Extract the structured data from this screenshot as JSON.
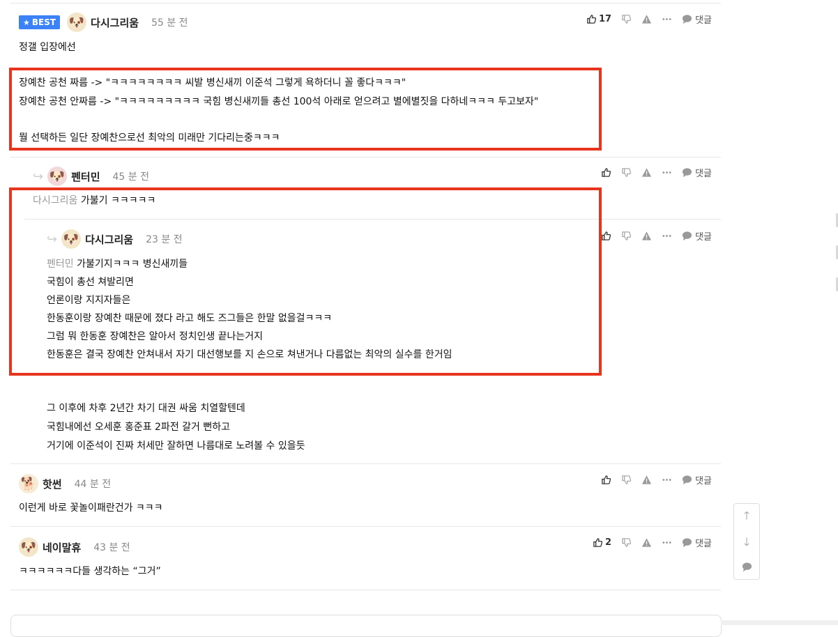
{
  "comments": [
    {
      "badge": "BEST",
      "author": "다시그리움",
      "time": "55 분 전",
      "likes": "17",
      "reply_label": "댓글",
      "lines": [
        "정갤 입장에선",
        "장예찬 공천 짜름 -> \"ㅋㅋㅋㅋㅋㅋㅋㅋ 씨발 병신새끼 이준석 그렇게 욕하더니 꼴 좋다ㅋㅋㅋ\"",
        "장예찬 공천 안짜름 -> \"ㅋㅋㅋㅋㅋㅋㅋㅋㅋ 국힘 병신새끼들 총선 100석 아래로 얻으려고 별에별짓을 다하네ㅋㅋㅋ 두고보자\"",
        "뭘 선택하든 일단 장예찬으로선 최악의 미래만 기다리는중ㅋㅋㅋ"
      ]
    },
    {
      "author": "펜터민",
      "time": "45 분 전",
      "reply_label": "댓글",
      "mention": "다시그리움",
      "text": "가불기 ㅋㅋㅋㅋㅋ"
    },
    {
      "author": "다시그리움",
      "time": "23 분 전",
      "reply_label": "댓글",
      "mention": "펜터민",
      "first_text": "가불기지ㅋㅋㅋ 병신새끼들",
      "lines": [
        "국힘이 총선 쳐발리면",
        "언론이랑 지지자들은",
        "한동훈이랑 장예찬 때문에 졌다 라고 해도 즈그들은 한말 없을걸ㅋㅋㅋ",
        "그럼 뭐 한동훈 장예찬은 알아서 정치인생 끝나는거지",
        "한동훈은 결국 장예찬 안쳐내서 자기 대선행보를 지 손으로 쳐낸거나 다름없는 최악의 실수를 한거임",
        "그 이후에 차후 2년간 차기 대권 싸움 치열할텐데",
        "국힘내에선 오세훈 홍준표 2파전 갈거 뻔하고",
        "거기에 이준석이 진짜 처세만 잘하면 나름대로 노려볼 수 있을듯"
      ]
    },
    {
      "author": "핫썬",
      "time": "44 분 전",
      "reply_label": "댓글",
      "text": "이런게 바로 꽃놀이패란건가 ㅋㅋㅋ"
    },
    {
      "author": "네이말휴",
      "time": "43 분 전",
      "likes": "2",
      "reply_label": "댓글",
      "text": "ㅋㅋㅋㅋㅋㅋ다들 생각하는 “그거”"
    }
  ],
  "icons": {
    "like": "thumbs-up-icon",
    "dislike": "thumbs-down-icon",
    "report": "warning-icon",
    "more": "more-icon",
    "reply": "speech-bubble-icon"
  },
  "colors": {
    "badge": "#3b82f6",
    "highlight_box": "#e8341c",
    "mention": "#999999"
  }
}
